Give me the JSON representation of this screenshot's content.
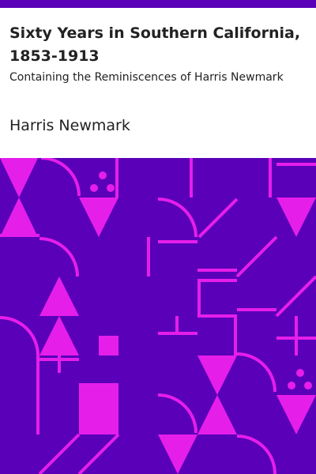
{
  "book": {
    "title": "Sixty Years in Southern California, 1853-1913",
    "subtitle": "Containing the Reminiscences of Harris Newmark",
    "author": "Harris Newmark"
  },
  "colors": {
    "accent_bar": "#5a00b8",
    "pattern_background": "#5a00b8",
    "pattern_shapes": "#e61eea",
    "text": "#222222"
  }
}
